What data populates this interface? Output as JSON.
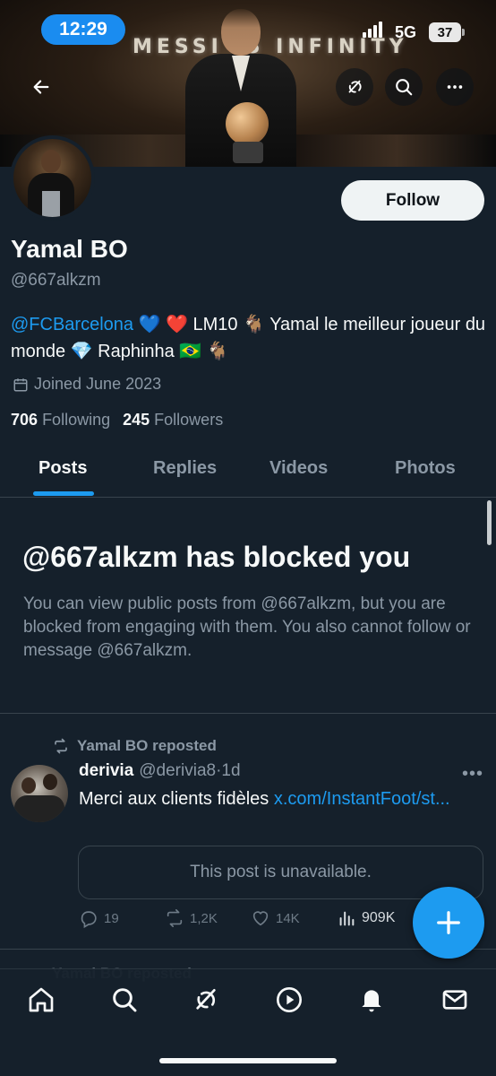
{
  "status_bar": {
    "time": "12:29",
    "network": "5G",
    "battery": "37"
  },
  "banner": {
    "text": "MESSI IS INFINITY"
  },
  "nav": {
    "icons": [
      "back-arrow-icon",
      "grok-icon",
      "search-icon",
      "more-icon"
    ]
  },
  "profile": {
    "display_name": "Yamal BO",
    "handle": "@667alkzm",
    "follow_label": "Follow",
    "bio": {
      "mention": "@FCBarcelona",
      "emoji_1": " 💙 ❤️ ",
      "text_1": "LM10 🐐 Yamal le meilleur joueur du monde 💎 Raphinha 🇧🇷 🐐"
    },
    "joined": "Joined June 2023",
    "following_count": "706",
    "following_label": "Following",
    "followers_count": "245",
    "followers_label": "Followers"
  },
  "tabs": [
    {
      "label": "Posts",
      "active": true
    },
    {
      "label": "Replies",
      "active": false
    },
    {
      "label": "Videos",
      "active": false
    },
    {
      "label": "Photos",
      "active": false
    }
  ],
  "blocked": {
    "title": "@667alkzm has blocked you",
    "body": "You can view public posts from @667alkzm, but you are blocked from engaging with them. You also cannot follow or message @667alkzm."
  },
  "tweet": {
    "repost_text": "Yamal BO reposted",
    "author_name": "derivia",
    "author_handle": "@derivia8",
    "separator": "·",
    "time": "1d",
    "text": "Merci aux clients fidèles ",
    "link": "x.com/InstantFoot/st...",
    "unavailable": "This post is unavailable.",
    "replies": "19",
    "reposts": "1,2K",
    "likes": "14K",
    "views": "909K"
  },
  "next_item": {
    "repost_text": "Yamal BO reposted"
  },
  "colors": {
    "accent": "#1d9bf0",
    "background": "#15202b",
    "secondary_text": "#8b98a5"
  },
  "bottom_nav": {
    "icons": [
      "home-icon",
      "search-icon",
      "grok-icon",
      "play-icon",
      "bell-icon",
      "mail-icon"
    ]
  }
}
